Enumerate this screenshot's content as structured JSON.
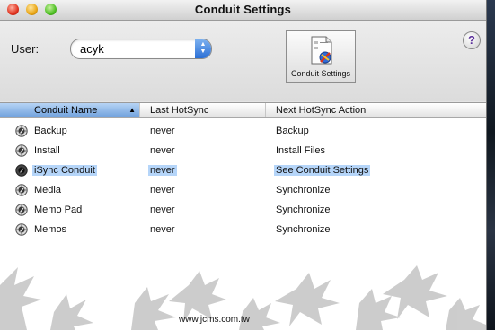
{
  "window": {
    "title": "Conduit Settings"
  },
  "toolbar": {
    "user_label": "User:",
    "user_value": "acyk",
    "conduit_settings_label": "Conduit Settings",
    "help_label": "?"
  },
  "table": {
    "columns": [
      "Conduit Name",
      "Last HotSync",
      "Next HotSync Action"
    ],
    "sort_indicator": "▲",
    "rows": [
      {
        "name": "Backup",
        "last": "never",
        "next": "Backup",
        "selected": false
      },
      {
        "name": "Install",
        "last": "never",
        "next": "Install Files",
        "selected": false
      },
      {
        "name": "iSync Conduit",
        "last": "never",
        "next": "See Conduit Settings",
        "selected": true
      },
      {
        "name": "Media",
        "last": "never",
        "next": "Synchronize",
        "selected": false
      },
      {
        "name": "Memo Pad",
        "last": "never",
        "next": "Synchronize",
        "selected": false
      },
      {
        "name": "Memos",
        "last": "never",
        "next": "Synchronize",
        "selected": false
      }
    ]
  },
  "watermark": {
    "text": "www.jcms.com.tw"
  },
  "colors": {
    "selection": "#b5d5f9",
    "sorted_header": "#6fa0dc",
    "window_bg": "#e4e4e4"
  },
  "icons": {
    "conduit": "conduit-gear-icon",
    "settings": "conduit-settings-icon",
    "help": "help-icon"
  }
}
